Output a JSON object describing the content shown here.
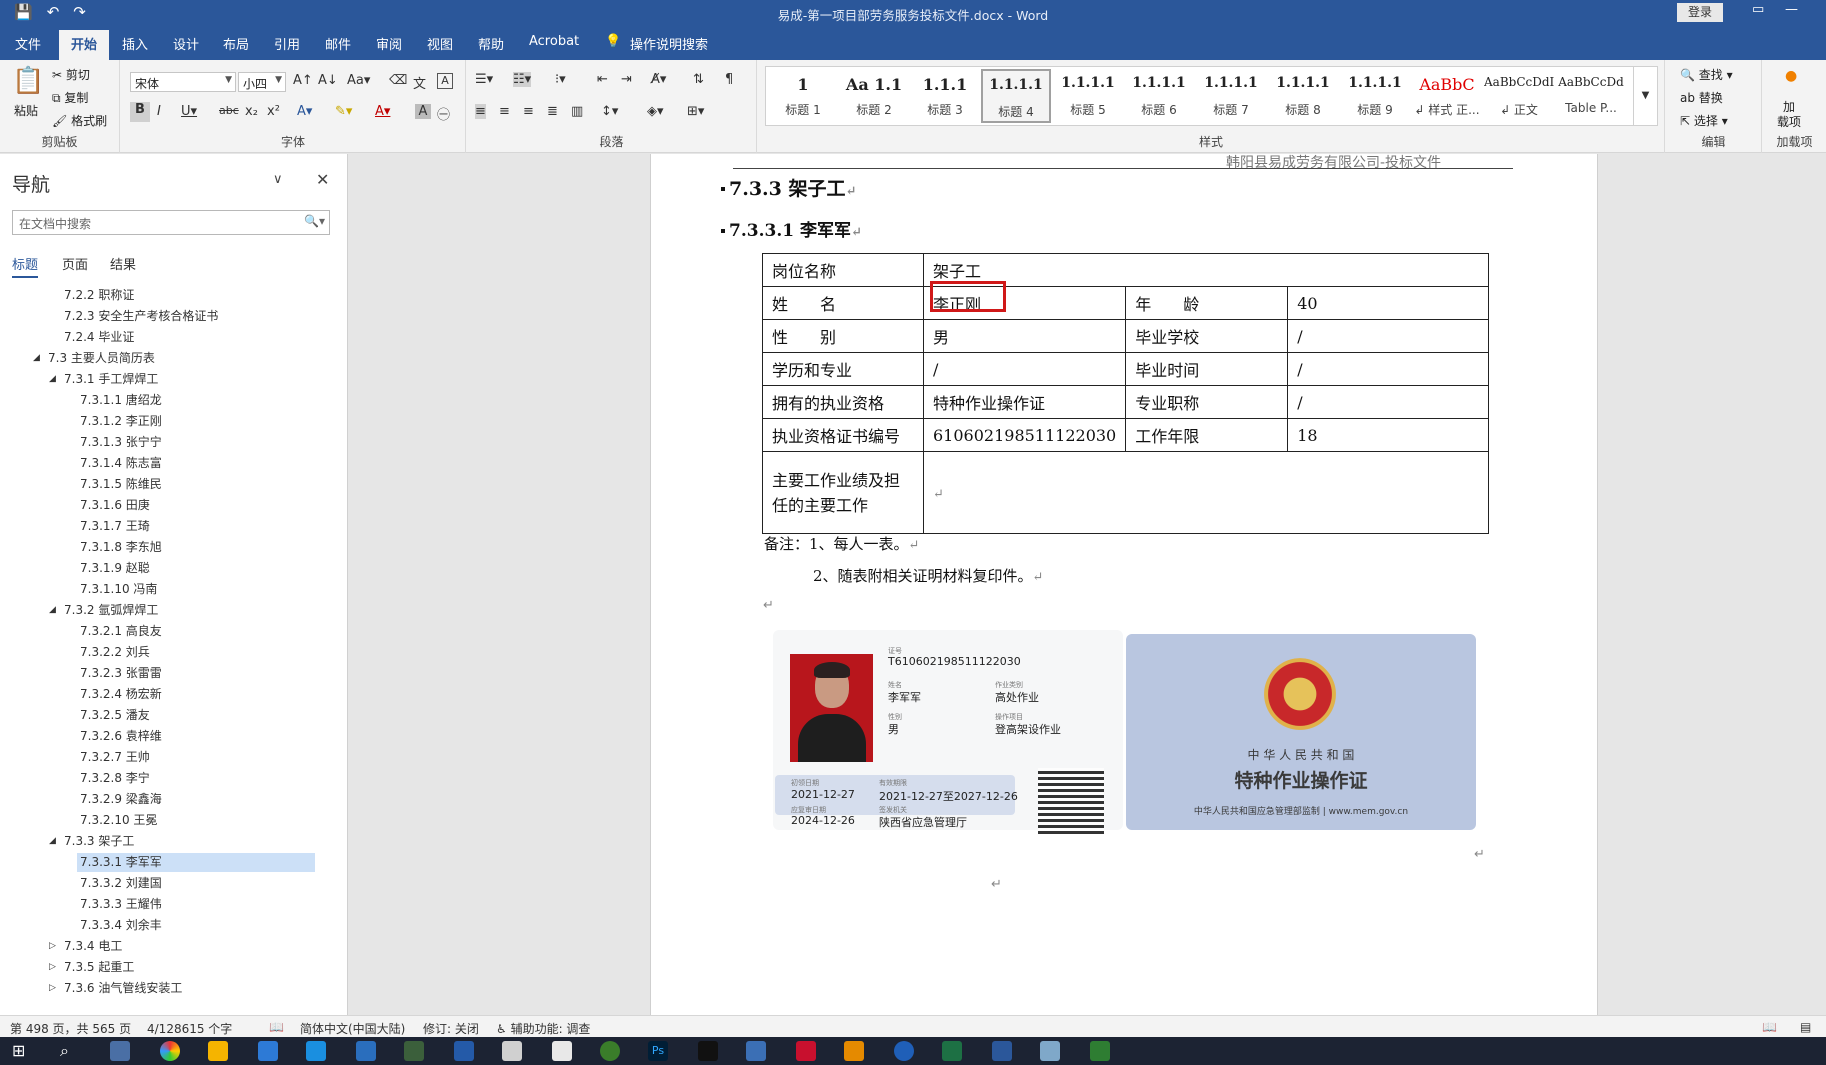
{
  "window": {
    "title": "易成-第一项目部劳务服务投标文件.docx  -  Word",
    "login_label": "登录",
    "qat": {
      "save_icon": "💾",
      "undo_icon": "↶",
      "redo_icon": "↷"
    }
  },
  "tabs": [
    "文件",
    "开始",
    "插入",
    "设计",
    "布局",
    "引用",
    "邮件",
    "审阅",
    "视图",
    "帮助",
    "Acrobat",
    "操作说明搜索"
  ],
  "active_tab": "开始",
  "ribbon": {
    "clipboard": {
      "paste": "粘贴",
      "cut": "剪切",
      "copy": "复制",
      "format_painter": "格式刷",
      "label": "剪贴板"
    },
    "font": {
      "name": "宋体",
      "size": "小四",
      "label": "字体"
    },
    "paragraph": {
      "label": "段落"
    },
    "styles": {
      "label": "样式",
      "items": [
        {
          "preview": "1",
          "name": "标题 1"
        },
        {
          "preview": "Aa 1.1",
          "name": "标题 2"
        },
        {
          "preview": "1.1.1",
          "name": "标题 3"
        },
        {
          "preview": "1.1.1.1",
          "name": "标题 4"
        },
        {
          "preview": "1.1.1.1",
          "name": "标题 5"
        },
        {
          "preview": "1.1.1.1",
          "name": "标题 6"
        },
        {
          "preview": "1.1.1.1",
          "name": "标题 7"
        },
        {
          "preview": "1.1.1.1",
          "name": "标题 8"
        },
        {
          "preview": "1.1.1.1",
          "name": "标题 9"
        },
        {
          "preview": "AaBbC",
          "name": "↲ 样式 正..."
        },
        {
          "preview": "AaBbCcDdI",
          "name": "↲ 正文"
        },
        {
          "preview": "AaBbCcDd",
          "name": "Table P..."
        }
      ],
      "selected_index": 3,
      "red_style_color": "#e00000"
    },
    "editing": {
      "find": "查找",
      "replace": "替换",
      "select": "选择",
      "label": "编辑"
    },
    "addins": {
      "button": "加\n载项",
      "label": "加载项"
    }
  },
  "nav": {
    "title": "导航",
    "search_placeholder": "在文档中搜索",
    "tabs": [
      "标题",
      "页面",
      "结果"
    ],
    "items": [
      {
        "text": "7.2.2 职称证",
        "level": 2
      },
      {
        "text": "7.2.3 安全生产考核合格证书",
        "level": 2
      },
      {
        "text": "7.2.4 毕业证",
        "level": 2
      },
      {
        "text": "7.3 主要人员简历表",
        "level": 1,
        "expanded": true
      },
      {
        "text": "7.3.1 手工焊焊工",
        "level": 2,
        "expanded": true
      },
      {
        "text": "7.3.1.1 唐绍龙",
        "level": 3
      },
      {
        "text": "7.3.1.2 李正刚",
        "level": 3
      },
      {
        "text": "7.3.1.3 张宁宁",
        "level": 3
      },
      {
        "text": "7.3.1.4 陈志富",
        "level": 3
      },
      {
        "text": "7.3.1.5 陈维民",
        "level": 3
      },
      {
        "text": "7.3.1.6 田庚",
        "level": 3
      },
      {
        "text": "7.3.1.7 王琦",
        "level": 3
      },
      {
        "text": "7.3.1.8 李东旭",
        "level": 3
      },
      {
        "text": "7.3.1.9 赵聪",
        "level": 3
      },
      {
        "text": "7.3.1.10 冯南",
        "level": 3
      },
      {
        "text": "7.3.2 氩弧焊焊工",
        "level": 2,
        "expanded": true
      },
      {
        "text": "7.3.2.1 高良友",
        "level": 3
      },
      {
        "text": "7.3.2.2 刘兵",
        "level": 3
      },
      {
        "text": "7.3.2.3 张雷雷",
        "level": 3
      },
      {
        "text": "7.3.2.4 杨宏新",
        "level": 3
      },
      {
        "text": "7.3.2.5 潘友",
        "level": 3
      },
      {
        "text": "7.3.2.6 袁梓维",
        "level": 3
      },
      {
        "text": "7.3.2.7 王帅",
        "level": 3
      },
      {
        "text": "7.3.2.8 李宁",
        "level": 3
      },
      {
        "text": "7.3.2.9 梁鑫海",
        "level": 3
      },
      {
        "text": "7.3.2.10 王冕",
        "level": 3
      },
      {
        "text": "7.3.3 架子工",
        "level": 2,
        "expanded": true
      },
      {
        "text": "7.3.3.1 李军军",
        "level": 3,
        "selected": true
      },
      {
        "text": "7.3.3.2 刘建国",
        "level": 3
      },
      {
        "text": "7.3.3.3 王耀伟",
        "level": 3
      },
      {
        "text": "7.3.3.4 刘余丰",
        "level": 3
      },
      {
        "text": "7.3.4 电工",
        "level": 2,
        "collapsed": true
      },
      {
        "text": "7.3.5 起重工",
        "level": 2,
        "collapsed": true
      },
      {
        "text": "7.3.6 油气管线安装工",
        "level": 2,
        "collapsed": true
      }
    ]
  },
  "document": {
    "header_text": "韩阳县易成劳务有限公司-投标文件",
    "heading1": "7.3.3 架子工",
    "heading2": "7.3.3.1 李军军",
    "table": {
      "post_label": "岗位名称",
      "post_value": "架子工",
      "name_label": "姓　　名",
      "name_value": "李正刚",
      "age_label": "年　　龄",
      "age_value": "40",
      "gender_label": "性　　别",
      "gender_value": "男",
      "school_label": "毕业学校",
      "school_value": "/",
      "edu_label": "学历和专业",
      "edu_value": "/",
      "grad_time_label": "毕业时间",
      "grad_time_value": "/",
      "qual_label": "拥有的执业资格",
      "qual_value": "特种作业操作证",
      "title_label": "专业职称",
      "title_value": "/",
      "cert_no_label": "执业资格证书编号",
      "cert_no_value": "610602198511122030",
      "years_label": "工作年限",
      "years_value": "18",
      "work_label_1": "主要工作业绩及担",
      "work_label_2": "任的主要工作",
      "work_value": ""
    },
    "note1": "备注：1、每人一表。",
    "note2": "2、随表附相关证明材料复印件。",
    "para_mark": "↵",
    "cert_front": {
      "id_label": "证号",
      "id_value": "T610602198511122030",
      "name_label": "姓名",
      "name_value": "李军军",
      "category_label": "作业类别",
      "category_value": "高处作业",
      "gender_label": "性别",
      "gender_value": "男",
      "item_label": "操作项目",
      "item_value": "登高架设作业",
      "first_issue_label": "初领日期",
      "first_issue_value": "2021-12-27",
      "valid_label": "有效期限",
      "valid_value": "2021-12-27至2027-12-26",
      "review_label": "应复审日期",
      "review_value": "2024-12-26",
      "issuer_label": "签发机关",
      "issuer_value": "陕西省应急管理厅"
    },
    "cert_back": {
      "country": "中 华 人 民 共 和 国",
      "title": "特种作业操作证",
      "footer": "中华人民共和国应急管理部监制 | www.mem.gov.cn"
    }
  },
  "status": {
    "page": "第 498 页，共 565 页",
    "words": "4/128615 个字",
    "language": "简体中文(中国大陆)",
    "track": "修订: 关闭",
    "accessibility": "辅助功能: 调查"
  },
  "colors": {
    "ribbon_blue": "#2b579a",
    "highlight_red": "#d01818",
    "nav_selected": "#cce0f7"
  }
}
